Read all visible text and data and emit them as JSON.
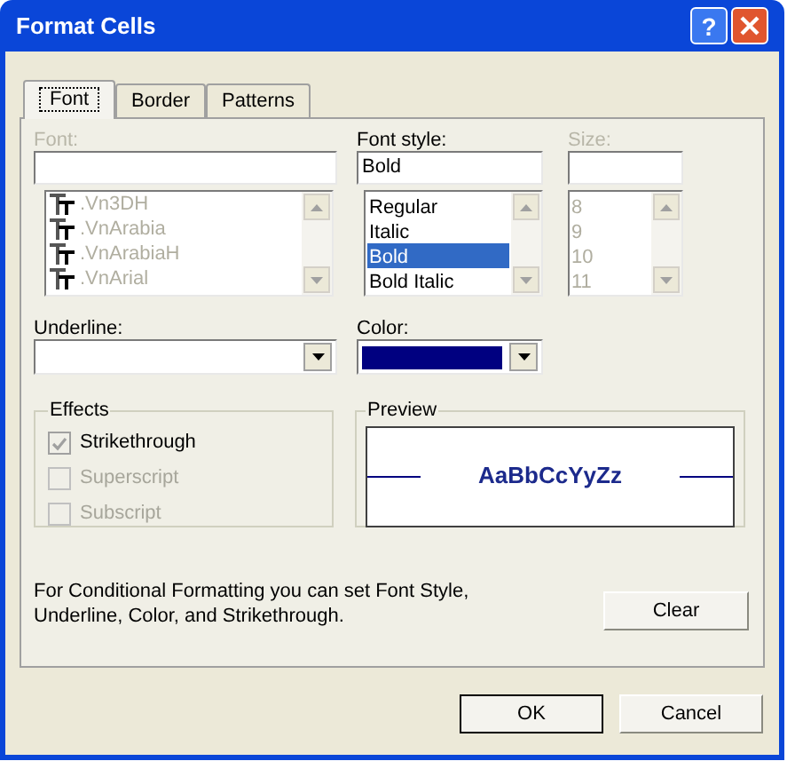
{
  "window": {
    "title": "Format Cells",
    "help": "?"
  },
  "tabs": [
    {
      "label": "Font",
      "selected": true
    },
    {
      "label": "Border",
      "selected": false
    },
    {
      "label": "Patterns",
      "selected": false
    }
  ],
  "font": {
    "label": "Font:",
    "disabled": true,
    "items": [
      ".Vn3DH",
      ".VnArabia",
      ".VnArabiaH",
      ".VnArial"
    ]
  },
  "font_style": {
    "label": "Font style:",
    "value": "Bold",
    "items": [
      {
        "label": "Regular",
        "selected": false
      },
      {
        "label": "Italic",
        "selected": false
      },
      {
        "label": "Bold",
        "selected": true
      },
      {
        "label": "Bold Italic",
        "selected": false
      }
    ]
  },
  "size": {
    "label": "Size:",
    "disabled": true,
    "items": [
      "8",
      "9",
      "10",
      "11"
    ]
  },
  "underline": {
    "label": "Underline:"
  },
  "color": {
    "label": "Color:",
    "color": "#000080"
  },
  "effects": {
    "title": "Effects",
    "items": [
      {
        "label": "Strikethrough",
        "checked": true,
        "disabled": false
      },
      {
        "label": "Superscript",
        "checked": false,
        "disabled": true
      },
      {
        "label": "Subscript",
        "checked": false,
        "disabled": true
      }
    ]
  },
  "preview": {
    "title": "Preview",
    "sample": "AaBbCcYyZz"
  },
  "note": "For Conditional Formatting you can set Font Style, Underline, Color, and Strikethrough.",
  "clear_button": "Clear",
  "buttons": [
    "OK",
    "Cancel"
  ]
}
